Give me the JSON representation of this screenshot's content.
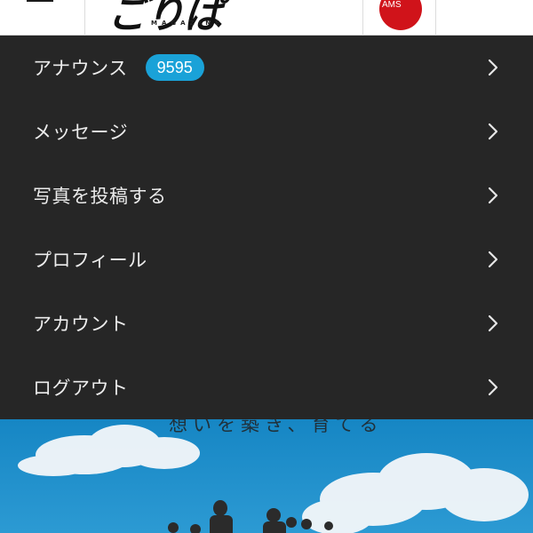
{
  "header": {
    "menu_icon": "hamburger-icon",
    "logo_text": "ごりぱ",
    "logo_subtitle": "MAGAZINE",
    "badge_text": "AMS",
    "accent_color": "#d0131a"
  },
  "menu": {
    "background": "#262626",
    "items": [
      {
        "label": "アナウンス",
        "badge": "9595",
        "icon": "chevron-right-icon"
      },
      {
        "label": "メッセージ",
        "icon": "chevron-right-icon"
      },
      {
        "label": "写真を投稿する",
        "icon": "chevron-right-icon"
      },
      {
        "label": "プロフィール",
        "icon": "chevron-right-icon"
      },
      {
        "label": "アカウント",
        "icon": "chevron-right-icon"
      },
      {
        "label": "ログアウト",
        "icon": "chevron-right-icon"
      }
    ],
    "badge_color": "#1aa2d8"
  },
  "hero": {
    "caption": "想いを築き、育てる"
  }
}
